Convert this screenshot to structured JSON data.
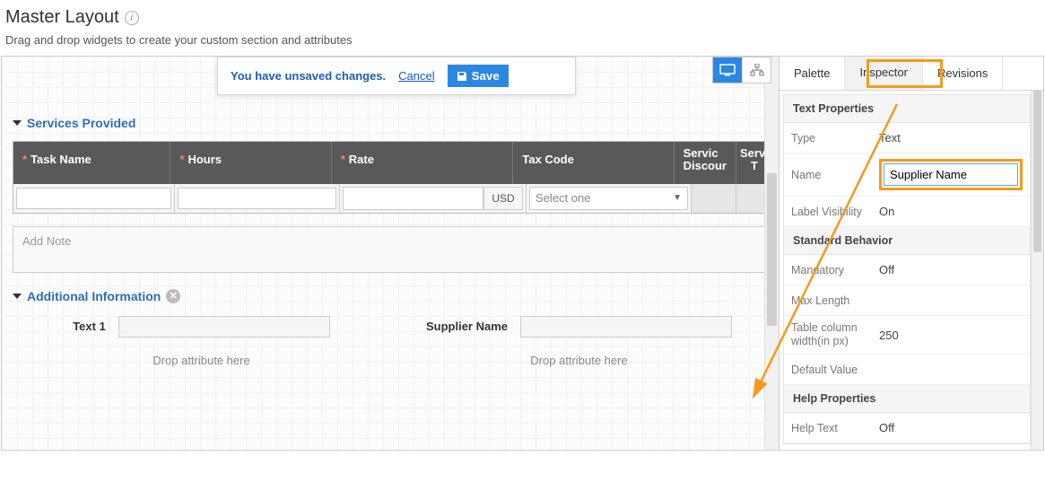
{
  "page": {
    "title": "Master Layout",
    "subtitle": "Drag and drop widgets to create your custom section and attributes"
  },
  "unsaved": {
    "message": "You have unsaved changes.",
    "cancel": "Cancel",
    "save": "Save"
  },
  "sections": {
    "services": {
      "title": "Services Provided",
      "columns": {
        "task": "Task Name",
        "hours": "Hours",
        "rate": "Rate",
        "tax": "Tax Code",
        "disc": "Servic",
        "disc2": "Discour",
        "servt": "Serv",
        "servt2": "T"
      },
      "currency": "USD",
      "tax_placeholder": "Select one",
      "note_placeholder": "Add Note"
    },
    "additional": {
      "title": "Additional Information",
      "field1_label": "Text 1",
      "field2_label": "Supplier Name",
      "drop_hint": "Drop attribute here"
    }
  },
  "tabs": {
    "palette": "Palette",
    "inspector": "Inspector",
    "revisions": "Revisions"
  },
  "inspector": {
    "text_properties": "Text Properties",
    "type_label": "Type",
    "type_value": "Text",
    "name_label": "Name",
    "name_value": "Supplier Name",
    "labelvis_label": "Label Visibility",
    "labelvis_value": "On",
    "standard_behavior": "Standard Behavior",
    "mandatory_label": "Mandatory",
    "mandatory_value": "Off",
    "maxlen_label": "Max Length",
    "colwidth_label": "Table column width(in px)",
    "colwidth_value": "250",
    "default_label": "Default Value",
    "help_properties": "Help Properties",
    "helptext_label": "Help Text",
    "helptext_value": "Off"
  }
}
